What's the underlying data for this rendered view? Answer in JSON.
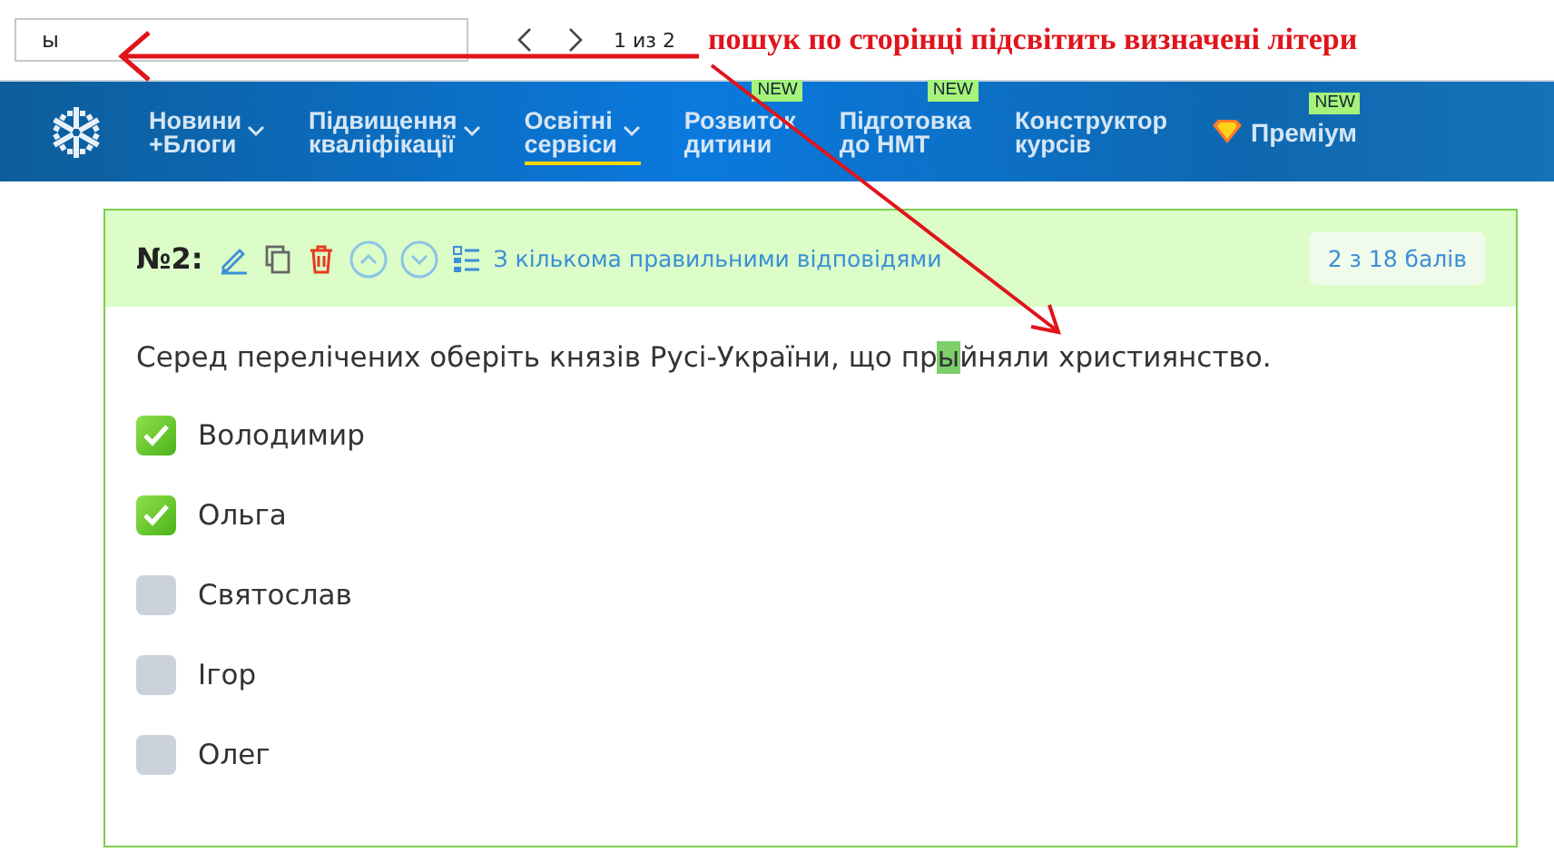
{
  "find_bar": {
    "value": "ы",
    "counter": "1 из 2"
  },
  "annotation": {
    "text": "пошук по сторінці підсвітить визначені літери"
  },
  "nav": {
    "items": [
      {
        "label": "Новини +Блоги",
        "dropdown": true,
        "selected": false
      },
      {
        "label": "Підвищення кваліфікації",
        "dropdown": true,
        "selected": false
      },
      {
        "label": "Освітні сервіси",
        "dropdown": true,
        "selected": true
      },
      {
        "label": "Розвиток дитини",
        "dropdown": false,
        "selected": false,
        "badge": "NEW"
      },
      {
        "label": "Підготовка до НМТ",
        "dropdown": false,
        "selected": false,
        "badge": "NEW"
      },
      {
        "label": "Конструктор курсів",
        "dropdown": false,
        "selected": false
      }
    ],
    "premium": {
      "label": "Преміум",
      "badge": "NEW"
    }
  },
  "question": {
    "number": "№2:",
    "type": "З кількома правильними відповідями",
    "score": "2 з 18 балів",
    "text_before": "Серед перелічених оберіть князів Русі-України, що пр",
    "text_match": "ы",
    "text_after": "йняли християнство.",
    "options": [
      {
        "label": "Володимир",
        "checked": true
      },
      {
        "label": "Ольга",
        "checked": true
      },
      {
        "label": "Святослав",
        "checked": false
      },
      {
        "label": "Ігор",
        "checked": false
      },
      {
        "label": "Олег",
        "checked": false
      }
    ]
  }
}
